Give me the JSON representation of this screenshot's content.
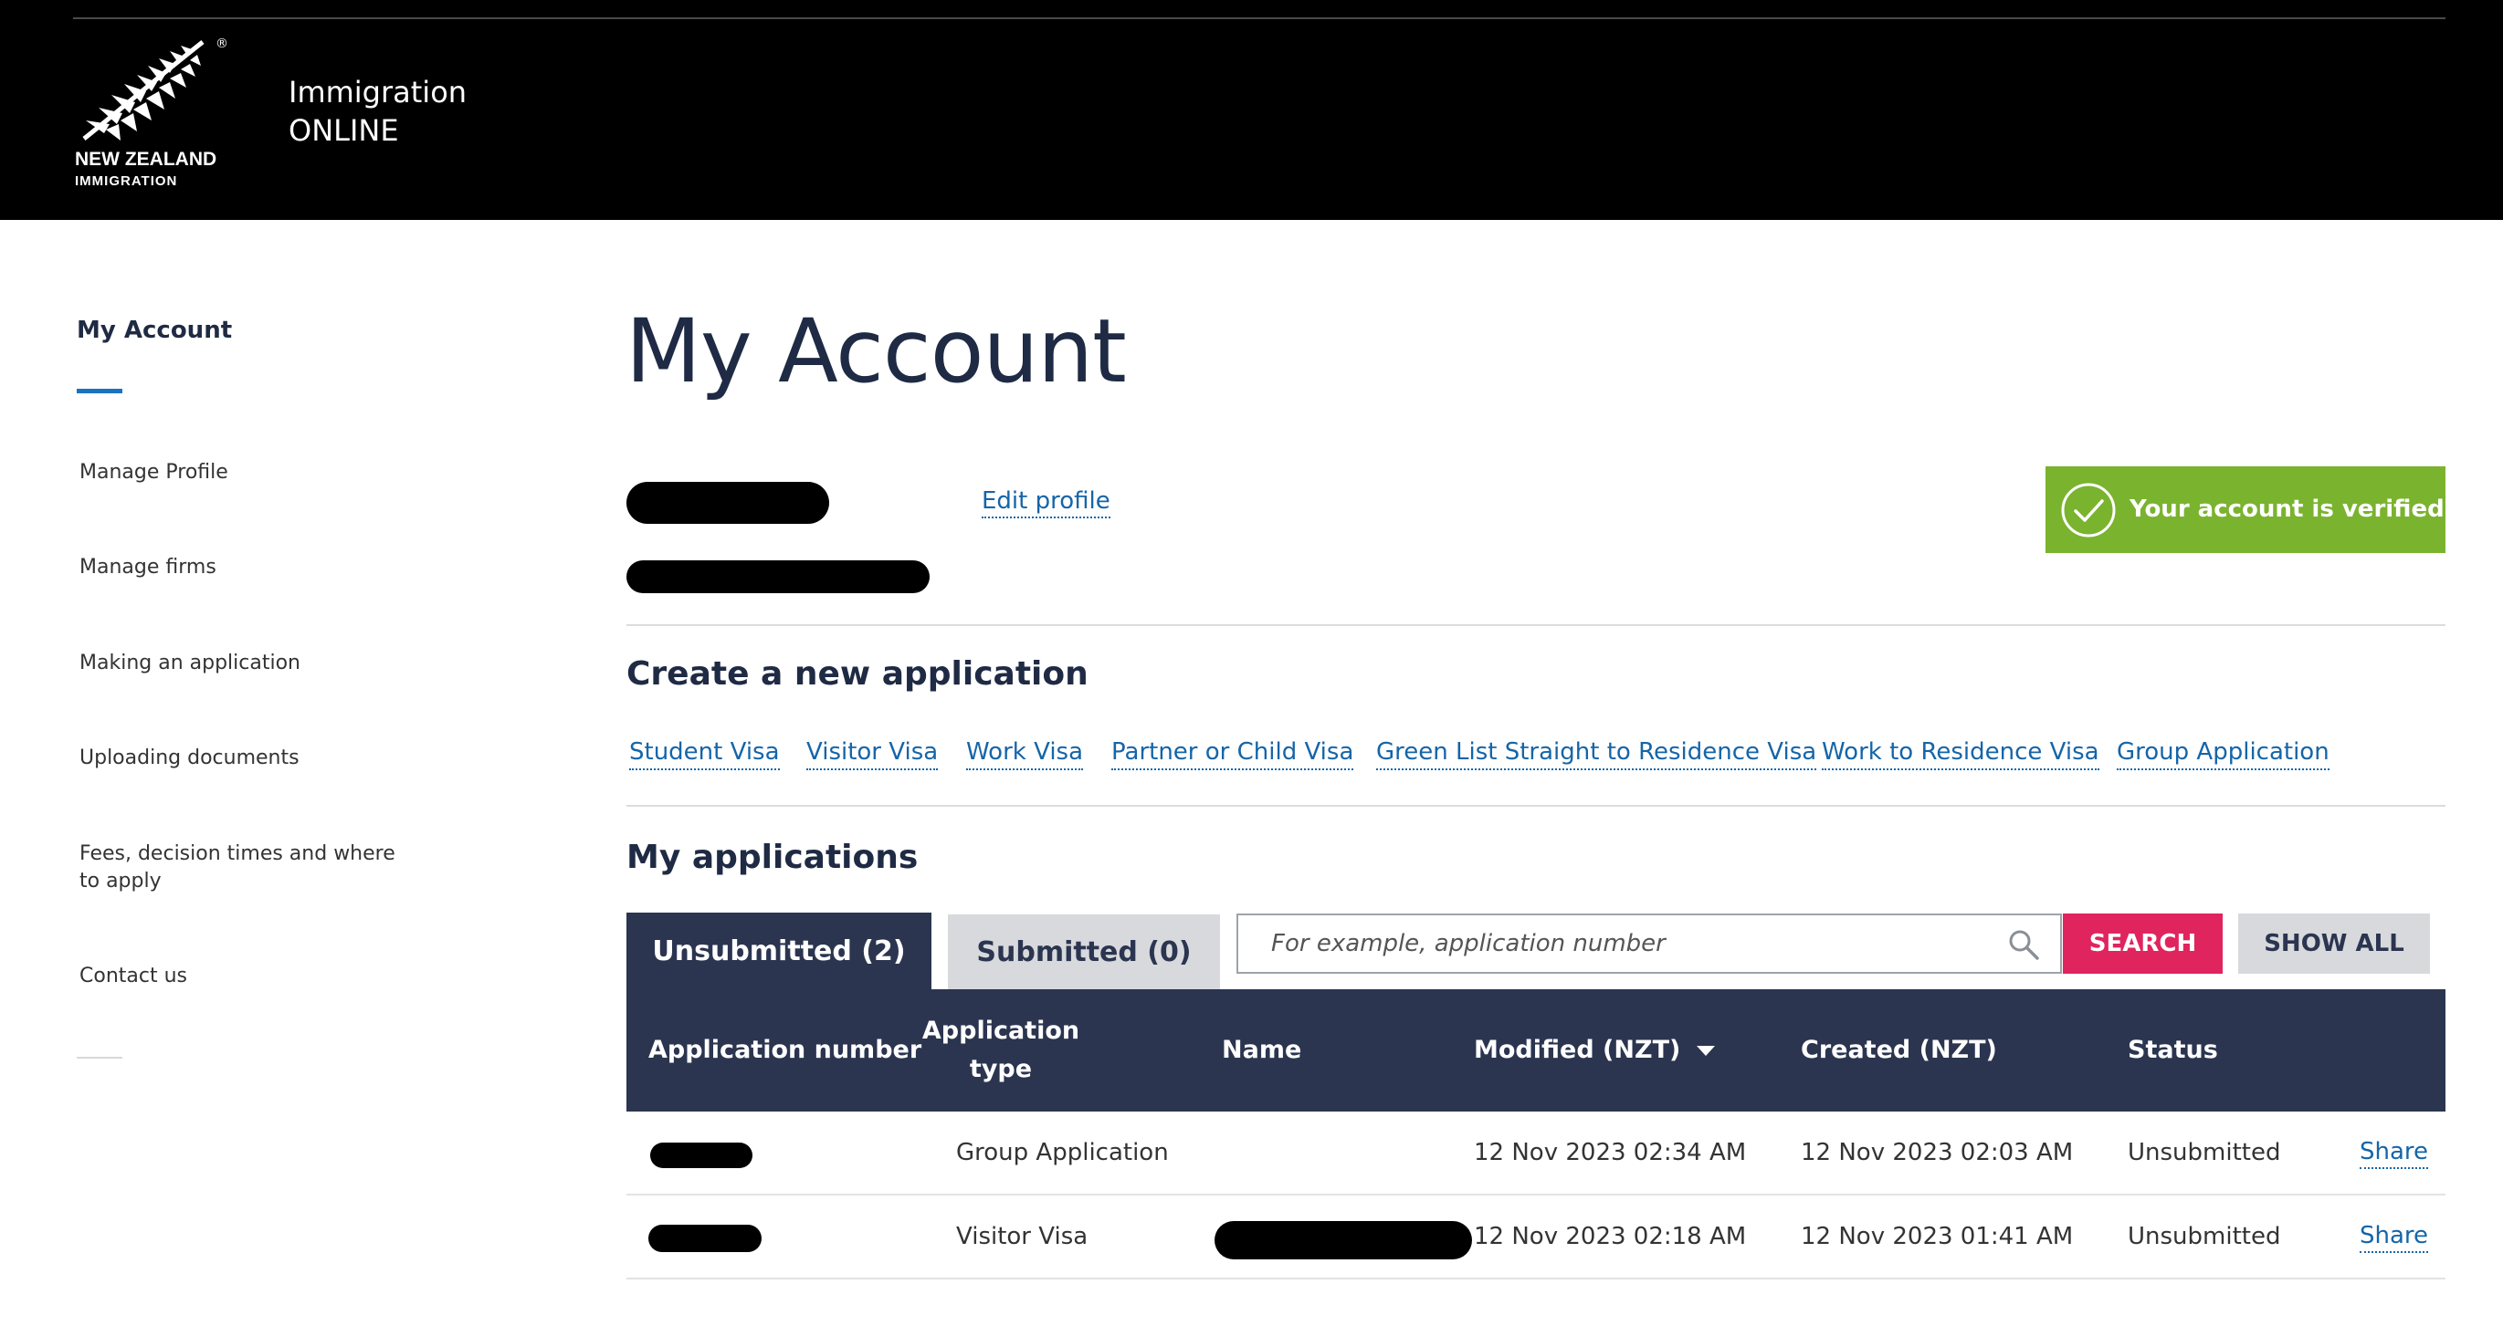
{
  "header": {
    "logo_line1": "NEW ZEALAND",
    "logo_line2": "IMMIGRATION",
    "logo_reg": "®",
    "app_title_line1": "Immigration",
    "app_title_line2": "ONLINE"
  },
  "sidebar": {
    "heading": "My Account",
    "items": [
      {
        "label": "Manage Profile"
      },
      {
        "label": "Manage firms"
      },
      {
        "label": "Making an application"
      },
      {
        "label": "Uploading documents"
      },
      {
        "label": "Fees, decision times and where to apply"
      },
      {
        "label": "Contact us"
      }
    ]
  },
  "main": {
    "title": "My Account",
    "edit_profile": "Edit profile",
    "verified": "Your account is verified",
    "create_heading": "Create a new application",
    "visa_links": [
      {
        "label": "Student Visa"
      },
      {
        "label": "Visitor Visa"
      },
      {
        "label": "Work Visa"
      },
      {
        "label": "Partner or Child Visa"
      },
      {
        "label": "Green List Straight to Residence Visa"
      },
      {
        "label": "Work to Residence Visa"
      },
      {
        "label": "Group Application"
      }
    ],
    "apps_heading": "My applications",
    "tabs": [
      {
        "label": "Unsubmitted (2)",
        "active": true
      },
      {
        "label": "Submitted (0)",
        "active": false
      }
    ],
    "search": {
      "placeholder": "For example, application number",
      "value": ""
    },
    "search_button": "SEARCH",
    "show_all_button": "SHOW ALL",
    "table": {
      "columns": [
        {
          "label": "Application number"
        },
        {
          "label": "Application\ntype"
        },
        {
          "label": "Name"
        },
        {
          "label": "Modified (NZT)"
        },
        {
          "label": "Created (NZT)"
        },
        {
          "label": "Status"
        }
      ],
      "rows": [
        {
          "type": "Group Application",
          "modified": "12 Nov 2023 02:34 AM",
          "created": "12 Nov 2023 02:03 AM",
          "status": "Unsubmitted",
          "action": "Share"
        },
        {
          "type": "Visitor Visa",
          "modified": "12 Nov 2023 02:18 AM",
          "created": "12 Nov 2023 01:41 AM",
          "status": "Unsubmitted",
          "action": "Share"
        }
      ]
    }
  },
  "colors": {
    "header_bg": "#000000",
    "navy": "#2b3550",
    "link": "#1565a8",
    "verified_green": "#7ab32e",
    "search_red": "#e0245e",
    "sidebar_accent": "#1a73c0"
  }
}
